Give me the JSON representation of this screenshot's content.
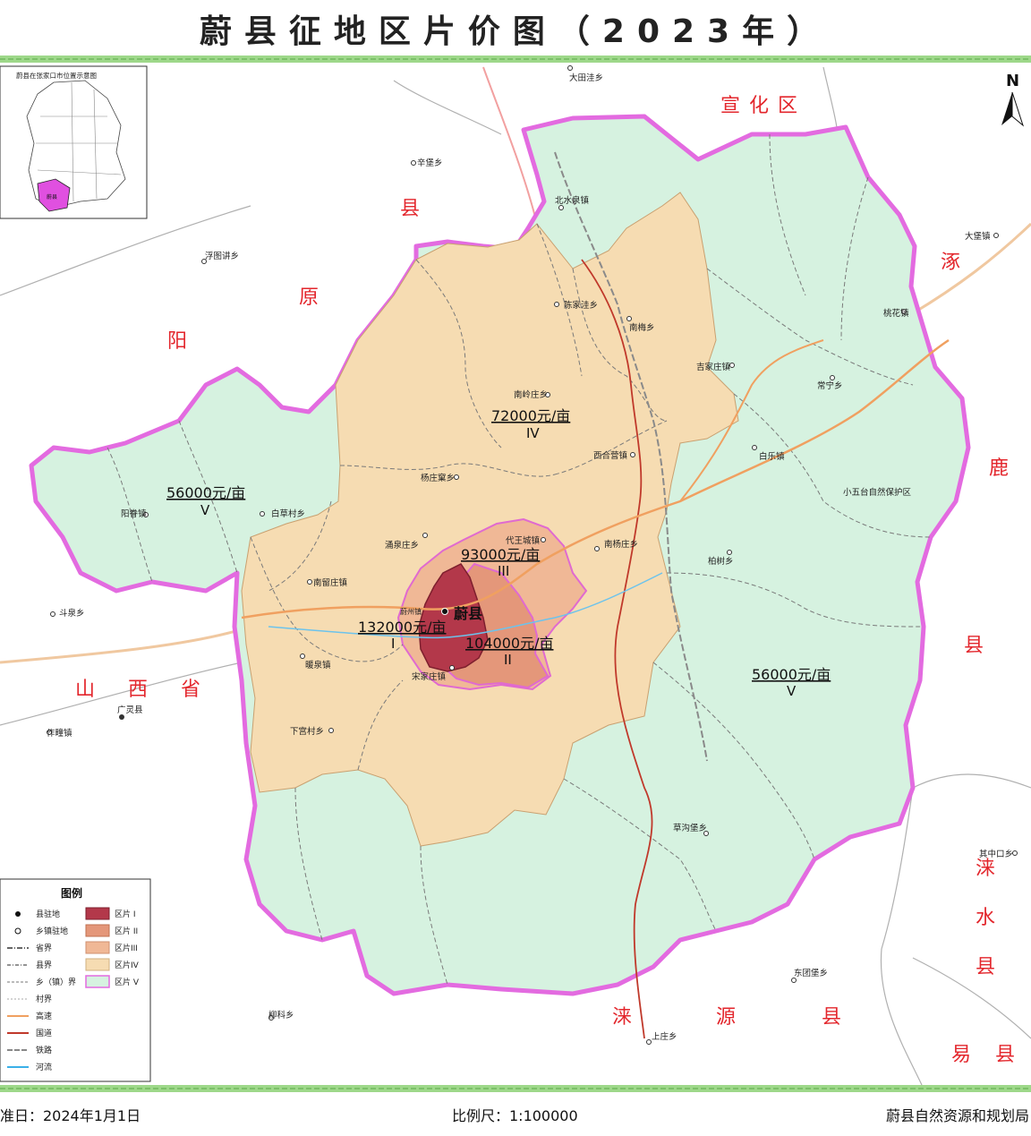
{
  "title": "蔚县征地区片价图（2023年）",
  "inset": {
    "caption": "蔚县在张家口市位置示意图",
    "highlight_label": "蔚县"
  },
  "compass": {
    "label": "N"
  },
  "neighbors": {
    "xuanhua": "宣化区",
    "yangyuan": [
      "阳",
      "原",
      "县"
    ],
    "zhuolu": [
      "涿",
      "鹿",
      "县"
    ],
    "shanxi": [
      "山",
      "西",
      "省"
    ],
    "laiyuan": [
      "涞",
      "源",
      "县"
    ],
    "laishui": [
      "涞",
      "水",
      "县"
    ],
    "yixian": [
      "易",
      "县"
    ]
  },
  "zones": {
    "z1": {
      "price": "132000元/亩",
      "grade": "I",
      "color": "#b3384a"
    },
    "z2": {
      "price": "104000元/亩",
      "grade": "II",
      "color": "#e4977a"
    },
    "z3": {
      "price": "93000元/亩",
      "grade": "III",
      "color": "#f0b896"
    },
    "z4": {
      "price": "72000元/亩",
      "grade": "IV",
      "color": "#f6dcb2"
    },
    "z5a": {
      "price": "56000元/亩",
      "grade": "V",
      "color": "#d6f2e0"
    },
    "z5b": {
      "price": "56000元/亩",
      "grade": "V"
    }
  },
  "county_seat": "蔚县",
  "county_seat_town": "蔚州镇",
  "places": {
    "datianwa": "大田洼乡",
    "xinbao": "辛堡乡",
    "futuwa": "浮图讲乡",
    "beishuiquan": "北水泉镇",
    "chenjiawa": "陈家洼乡",
    "nanmei": "南梅乡",
    "jijiazhuang": "吉家庄镇",
    "changning": "常宁乡",
    "taohua": "桃花镇",
    "dabu": "大堡镇",
    "nanlingzhuang": "南岭庄乡",
    "xiheying": "西合营镇",
    "baile": "白乐镇",
    "xiaowutai": "小五台自然保护区",
    "yangzhuangke": "杨庄窠乡",
    "yangjuan": "阳眷镇",
    "baicaocun": "白草村乡",
    "yongquanzhuang": "涌泉庄乡",
    "daiwangcheng": "代王城镇",
    "nanyangzhuang": "南杨庄乡",
    "baishu": "柏树乡",
    "nanliuzhuang": "南留庄镇",
    "douquan": "斗泉乡",
    "nuanquan": "暖泉镇",
    "songjiazhuang": "宋家庄镇",
    "guangling": "广灵县",
    "zuoshui": "作疃镇",
    "xiagongcun": "下宫村乡",
    "caogoubao": "草沟堡乡",
    "qizhongkou": "其中口乡",
    "dongtuanbao": "东团堡乡",
    "liuke": "柳科乡",
    "shangzhuang": "上庄乡"
  },
  "legend": {
    "title": "图例",
    "items": [
      {
        "label": "县驻地",
        "icon": "county-seat-icon"
      },
      {
        "label": "乡镇驻地",
        "icon": "township-icon"
      },
      {
        "label": "省界",
        "icon": "province-border-icon"
      },
      {
        "label": "县界",
        "icon": "county-border-icon"
      },
      {
        "label": "乡（镇）界",
        "icon": "town-border-icon"
      },
      {
        "label": "村界",
        "icon": "village-border-icon"
      },
      {
        "label": "高速",
        "icon": "expressway-icon",
        "color": "#f0a060"
      },
      {
        "label": "国道",
        "icon": "national-road-icon",
        "color": "#c0392b"
      },
      {
        "label": "铁路",
        "icon": "railway-icon",
        "color": "#888888"
      },
      {
        "label": "河流",
        "icon": "river-icon",
        "color": "#3ab0e8"
      }
    ],
    "zone_items": [
      {
        "label": "区片 I",
        "color": "#b3384a"
      },
      {
        "label": "区片 II",
        "color": "#e4977a"
      },
      {
        "label": "区片III",
        "color": "#f0b896"
      },
      {
        "label": "区片IV",
        "color": "#f6dcb2"
      },
      {
        "label": "区片 V",
        "color": "#d6f2e0"
      }
    ]
  },
  "footer": {
    "date": "准日：2024年1月1日",
    "scale": "比例尺：1:100000",
    "org": "蔚县自然资源和规划局"
  }
}
